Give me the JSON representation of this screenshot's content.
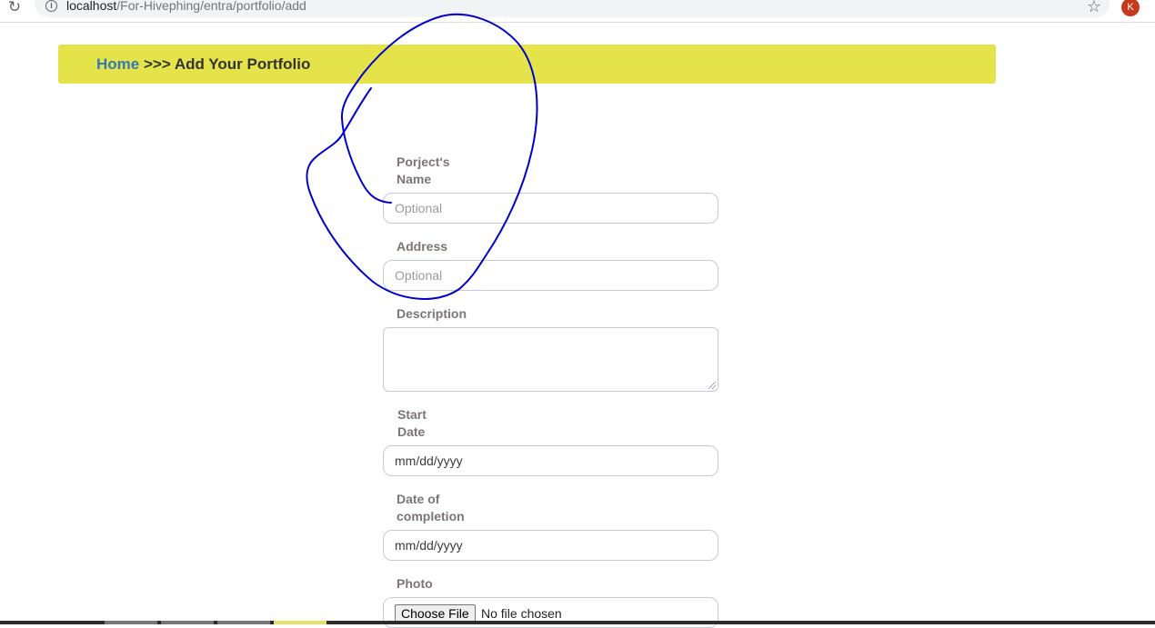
{
  "browser": {
    "url_host": "localhost",
    "url_path": "/For-Hivephing/entra/portfolio/add",
    "profile_initial": "K"
  },
  "breadcrumb": {
    "home": "Home",
    "separator": " >>> ",
    "current": "Add Your Portfolio"
  },
  "form": {
    "project_name": {
      "label_line1": "Porject's",
      "label_line2": "Name",
      "placeholder": "Optional"
    },
    "address": {
      "label": "Address",
      "placeholder": "Optional"
    },
    "description": {
      "label": "Description",
      "value": ""
    },
    "start_date": {
      "label_line1": "Start",
      "label_line2": "Date",
      "value": "mm/dd/yyyy"
    },
    "completion_date": {
      "label_line1": "Date of",
      "label_line2": "completion",
      "value": "mm/dd/yyyy"
    },
    "photo": {
      "label": "Photo",
      "button": "Choose File",
      "status": "No file chosen"
    }
  },
  "colors": {
    "breadcrumb_bg": "#e4e44a",
    "link": "#3579b3",
    "label": "#7d7575",
    "annotation_stroke": "#0000cc"
  },
  "icons": [
    "reload-icon",
    "info-icon",
    "star-icon"
  ]
}
